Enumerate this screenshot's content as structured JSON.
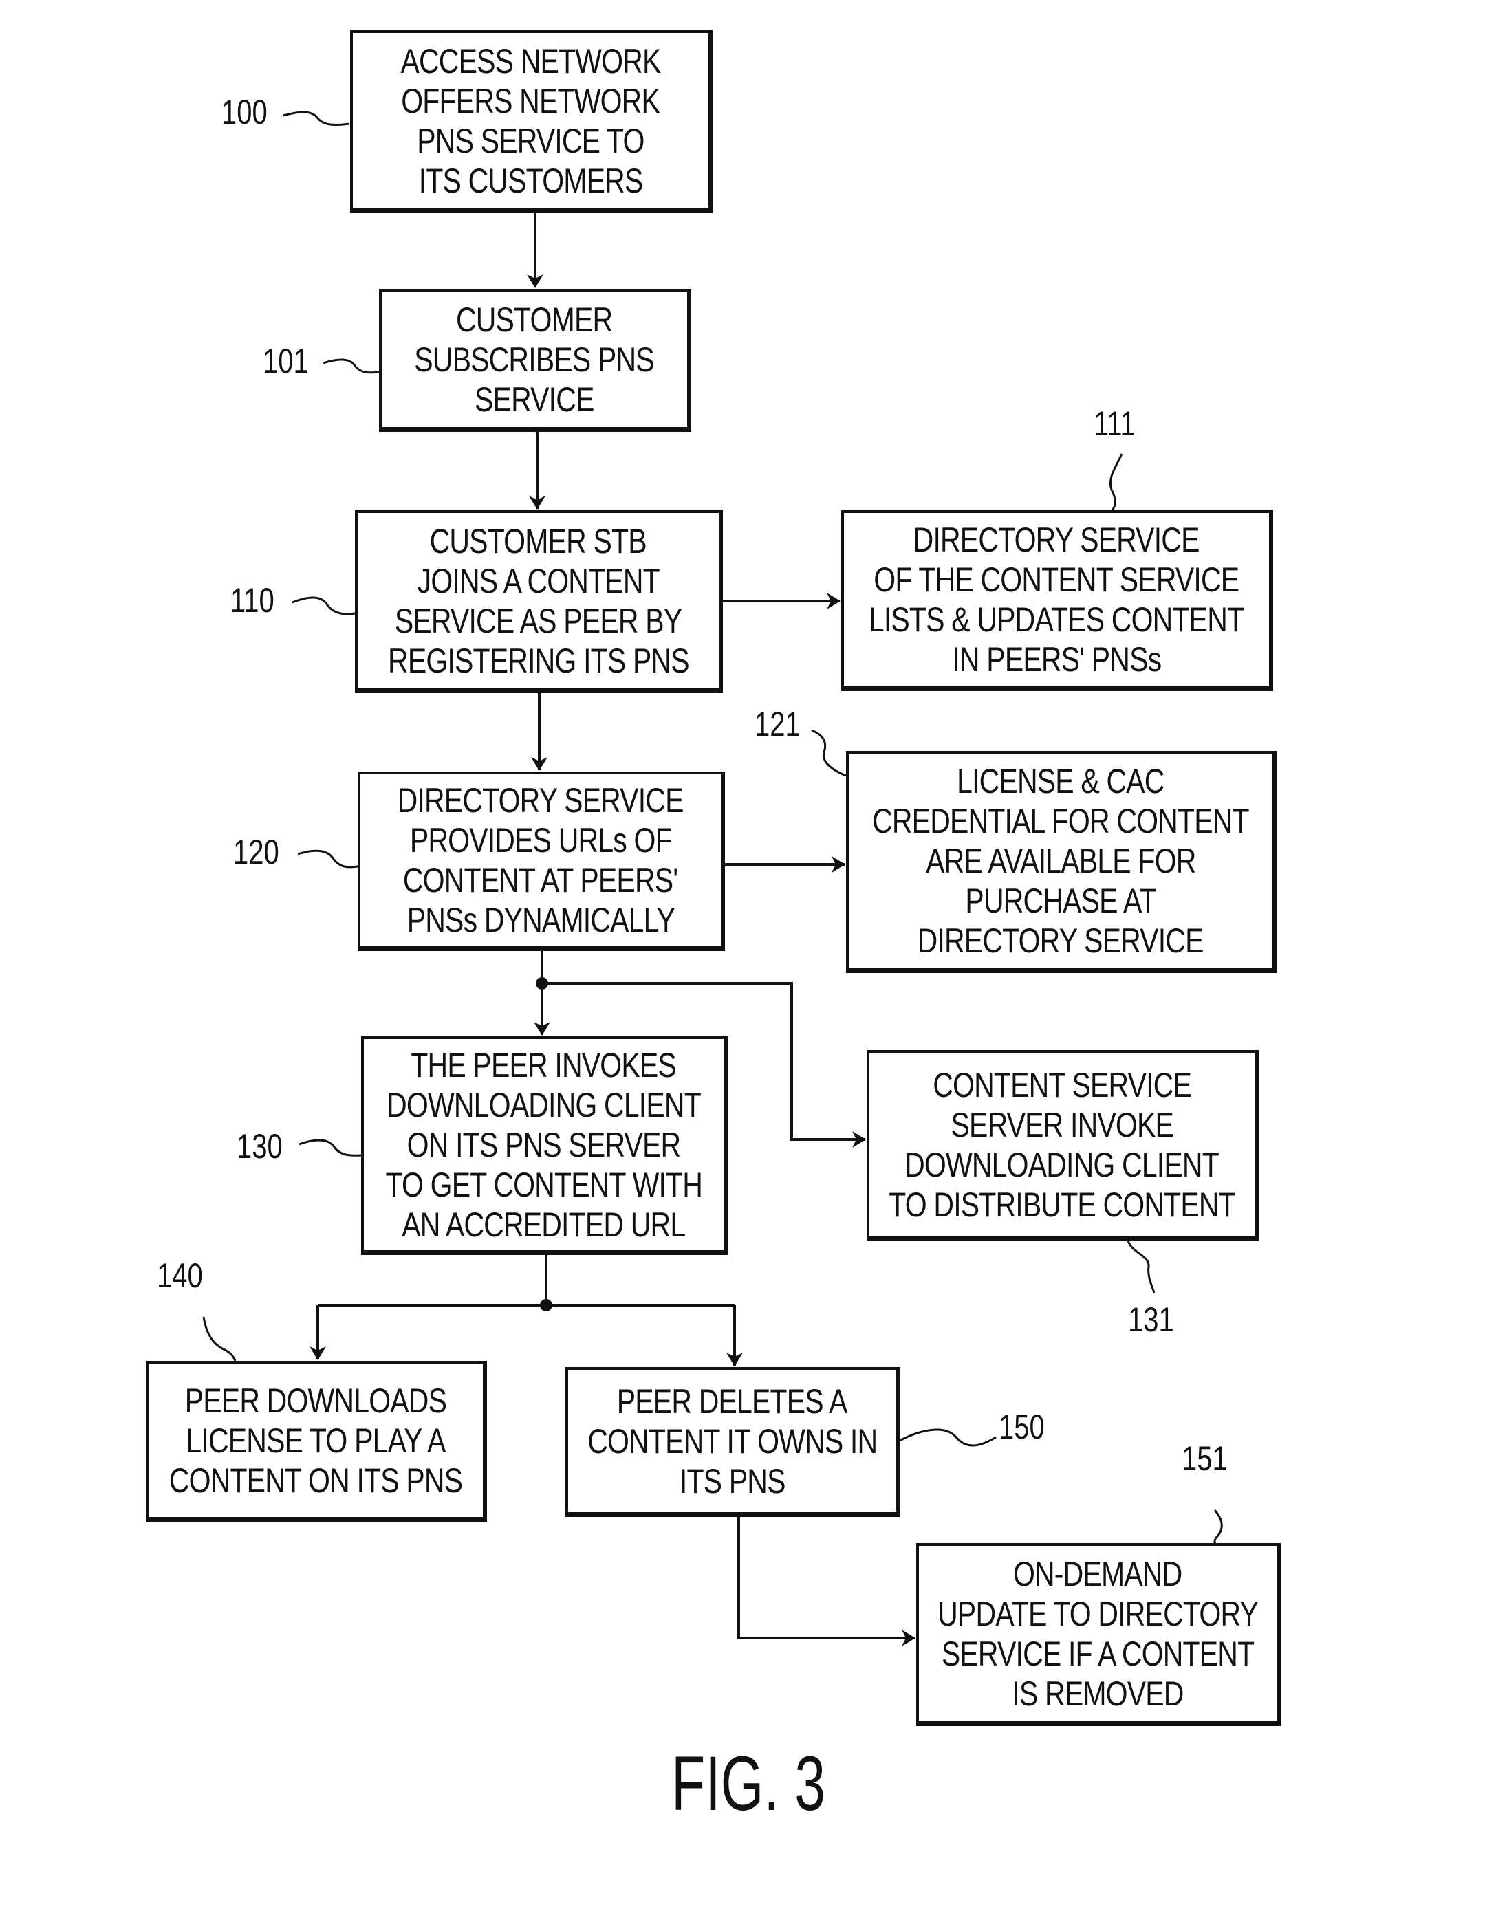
{
  "figure": {
    "caption": "FIG. 3",
    "steps": [
      {
        "id": "100",
        "ref": "100",
        "lines": [
          "ACCESS NETWORK",
          "OFFERS NETWORK",
          "PNS SERVICE TO",
          "ITS CUSTOMERS"
        ]
      },
      {
        "id": "101",
        "ref": "101",
        "lines": [
          "CUSTOMER",
          "SUBSCRIBES PNS",
          "SERVICE"
        ]
      },
      {
        "id": "110",
        "ref": "110",
        "lines": [
          "CUSTOMER STB",
          "JOINS A CONTENT",
          "SERVICE AS PEER BY",
          "REGISTERING ITS PNS"
        ]
      },
      {
        "id": "111",
        "ref": "111",
        "lines": [
          "DIRECTORY SERVICE",
          "OF THE CONTENT SERVICE",
          "LISTS & UPDATES CONTENT",
          "IN PEERS' PNSs"
        ]
      },
      {
        "id": "120",
        "ref": "120",
        "lines": [
          "DIRECTORY SERVICE",
          "PROVIDES URLs OF",
          "CONTENT AT PEERS'",
          "PNSs DYNAMICALLY"
        ]
      },
      {
        "id": "121",
        "ref": "121",
        "lines": [
          "LICENSE & CAC",
          "CREDENTIAL FOR CONTENT",
          "ARE AVAILABLE FOR",
          "PURCHASE AT",
          "DIRECTORY SERVICE"
        ]
      },
      {
        "id": "130",
        "ref": "130",
        "lines": [
          "THE PEER INVOKES",
          "DOWNLOADING CLIENT",
          "ON ITS PNS SERVER",
          "TO GET CONTENT WITH",
          "AN ACCREDITED URL"
        ]
      },
      {
        "id": "131",
        "ref": "131",
        "lines": [
          "CONTENT SERVICE",
          "SERVER INVOKE",
          "DOWNLOADING CLIENT",
          "TO DISTRIBUTE CONTENT"
        ]
      },
      {
        "id": "140",
        "ref": "140",
        "lines": [
          "PEER DOWNLOADS",
          "LICENSE TO PLAY A",
          "CONTENT ON ITS PNS"
        ]
      },
      {
        "id": "150",
        "ref": "150",
        "lines": [
          "PEER DELETES A",
          "CONTENT IT OWNS IN",
          "ITS PNS"
        ]
      },
      {
        "id": "151",
        "ref": "151",
        "lines": [
          "ON-DEMAND",
          "UPDATE TO DIRECTORY",
          "SERVICE IF A CONTENT",
          "IS REMOVED"
        ]
      }
    ],
    "connections": [
      {
        "from": "100",
        "to": "101"
      },
      {
        "from": "101",
        "to": "110"
      },
      {
        "from": "110",
        "to": "111"
      },
      {
        "from": "110",
        "to": "120"
      },
      {
        "from": "120",
        "to": "121"
      },
      {
        "from": "120",
        "to": "130"
      },
      {
        "from": "120",
        "to": "131"
      },
      {
        "from": "130",
        "to": "140"
      },
      {
        "from": "130",
        "to": "150"
      },
      {
        "from": "150",
        "to": "151"
      }
    ]
  }
}
